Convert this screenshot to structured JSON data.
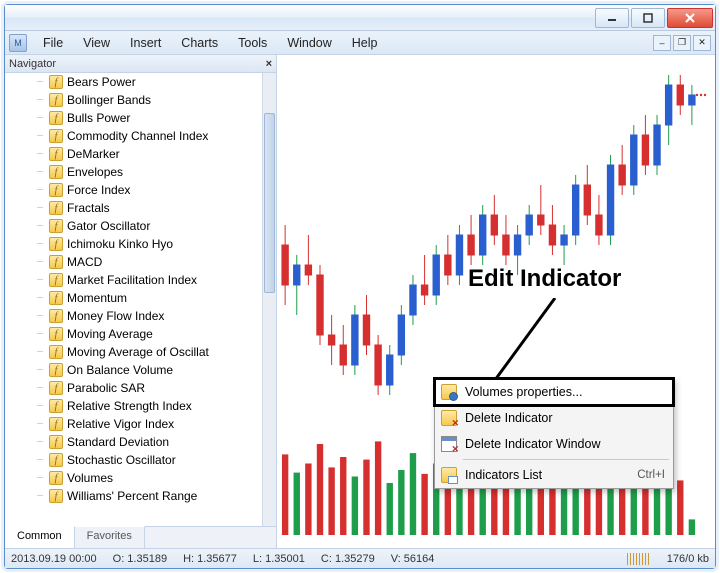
{
  "menubar": {
    "items": [
      "File",
      "View",
      "Insert",
      "Charts",
      "Tools",
      "Window",
      "Help"
    ]
  },
  "navigator": {
    "title": "Navigator",
    "tabs": {
      "active": "Common",
      "inactive": "Favorites"
    },
    "indicators": [
      "Bears Power",
      "Bollinger Bands",
      "Bulls Power",
      "Commodity Channel Index",
      "DeMarker",
      "Envelopes",
      "Force Index",
      "Fractals",
      "Gator Oscillator",
      "Ichimoku Kinko Hyo",
      "MACD",
      "Market Facilitation Index",
      "Momentum",
      "Money Flow Index",
      "Moving Average",
      "Moving Average of Oscillat",
      "On Balance Volume",
      "Parabolic SAR",
      "Relative Strength Index",
      "Relative Vigor Index",
      "Standard Deviation",
      "Stochastic Oscillator",
      "Volumes",
      "Williams' Percent Range"
    ]
  },
  "context_menu": {
    "items": [
      {
        "label": "Volumes properties...",
        "icon": "prop",
        "highlight": true
      },
      {
        "label": "Delete Indicator",
        "icon": "del"
      },
      {
        "label": "Delete Indicator Window",
        "icon": "delwin"
      },
      {
        "label": "Indicators List",
        "icon": "list",
        "accel": "Ctrl+I",
        "sep_before": true
      }
    ]
  },
  "annotation": {
    "text": "Edit Indicator"
  },
  "statusbar": {
    "datetime": "2013.09.19 00:00",
    "open": "O: 1.35189",
    "high": "H: 1.35677",
    "low": "L: 1.35001",
    "close": "C: 1.35279",
    "volume": "V: 56164",
    "traffic": "176/0 kb"
  },
  "chart_data": {
    "type": "candlestick+histogram",
    "note": "Approximate OHLC candles and volume histogram as visually depicted; values estimated from relative pixel heights (no axis labels visible).",
    "price_range_est": [
      1.335,
      1.367
    ],
    "candles": [
      {
        "o": 1.35,
        "h": 1.352,
        "l": 1.344,
        "c": 1.346,
        "dir": "down"
      },
      {
        "o": 1.346,
        "h": 1.349,
        "l": 1.343,
        "c": 1.348,
        "dir": "up"
      },
      {
        "o": 1.348,
        "h": 1.351,
        "l": 1.346,
        "c": 1.347,
        "dir": "down"
      },
      {
        "o": 1.347,
        "h": 1.348,
        "l": 1.34,
        "c": 1.341,
        "dir": "down"
      },
      {
        "o": 1.341,
        "h": 1.343,
        "l": 1.338,
        "c": 1.34,
        "dir": "down"
      },
      {
        "o": 1.34,
        "h": 1.342,
        "l": 1.337,
        "c": 1.338,
        "dir": "down"
      },
      {
        "o": 1.338,
        "h": 1.344,
        "l": 1.337,
        "c": 1.343,
        "dir": "up"
      },
      {
        "o": 1.343,
        "h": 1.345,
        "l": 1.339,
        "c": 1.34,
        "dir": "down"
      },
      {
        "o": 1.34,
        "h": 1.341,
        "l": 1.335,
        "c": 1.336,
        "dir": "down"
      },
      {
        "o": 1.336,
        "h": 1.34,
        "l": 1.335,
        "c": 1.339,
        "dir": "up"
      },
      {
        "o": 1.339,
        "h": 1.344,
        "l": 1.338,
        "c": 1.343,
        "dir": "up"
      },
      {
        "o": 1.343,
        "h": 1.347,
        "l": 1.342,
        "c": 1.346,
        "dir": "up"
      },
      {
        "o": 1.346,
        "h": 1.349,
        "l": 1.344,
        "c": 1.345,
        "dir": "down"
      },
      {
        "o": 1.345,
        "h": 1.35,
        "l": 1.344,
        "c": 1.349,
        "dir": "up"
      },
      {
        "o": 1.349,
        "h": 1.351,
        "l": 1.346,
        "c": 1.347,
        "dir": "down"
      },
      {
        "o": 1.347,
        "h": 1.352,
        "l": 1.346,
        "c": 1.351,
        "dir": "up"
      },
      {
        "o": 1.351,
        "h": 1.353,
        "l": 1.348,
        "c": 1.349,
        "dir": "down"
      },
      {
        "o": 1.349,
        "h": 1.354,
        "l": 1.348,
        "c": 1.353,
        "dir": "up"
      },
      {
        "o": 1.353,
        "h": 1.355,
        "l": 1.35,
        "c": 1.351,
        "dir": "down"
      },
      {
        "o": 1.351,
        "h": 1.353,
        "l": 1.348,
        "c": 1.349,
        "dir": "down"
      },
      {
        "o": 1.349,
        "h": 1.352,
        "l": 1.347,
        "c": 1.351,
        "dir": "up"
      },
      {
        "o": 1.351,
        "h": 1.354,
        "l": 1.35,
        "c": 1.353,
        "dir": "up"
      },
      {
        "o": 1.353,
        "h": 1.356,
        "l": 1.351,
        "c": 1.352,
        "dir": "down"
      },
      {
        "o": 1.352,
        "h": 1.354,
        "l": 1.349,
        "c": 1.35,
        "dir": "down"
      },
      {
        "o": 1.35,
        "h": 1.352,
        "l": 1.348,
        "c": 1.351,
        "dir": "up"
      },
      {
        "o": 1.351,
        "h": 1.357,
        "l": 1.35,
        "c": 1.356,
        "dir": "up"
      },
      {
        "o": 1.356,
        "h": 1.358,
        "l": 1.352,
        "c": 1.353,
        "dir": "down"
      },
      {
        "o": 1.353,
        "h": 1.355,
        "l": 1.35,
        "c": 1.351,
        "dir": "down"
      },
      {
        "o": 1.351,
        "h": 1.359,
        "l": 1.35,
        "c": 1.358,
        "dir": "up"
      },
      {
        "o": 1.358,
        "h": 1.36,
        "l": 1.355,
        "c": 1.356,
        "dir": "down"
      },
      {
        "o": 1.356,
        "h": 1.362,
        "l": 1.355,
        "c": 1.361,
        "dir": "up"
      },
      {
        "o": 1.361,
        "h": 1.363,
        "l": 1.357,
        "c": 1.358,
        "dir": "down"
      },
      {
        "o": 1.358,
        "h": 1.363,
        "l": 1.357,
        "c": 1.362,
        "dir": "up"
      },
      {
        "o": 1.362,
        "h": 1.367,
        "l": 1.36,
        "c": 1.366,
        "dir": "up"
      },
      {
        "o": 1.366,
        "h": 1.367,
        "l": 1.363,
        "c": 1.364,
        "dir": "down"
      },
      {
        "o": 1.364,
        "h": 1.366,
        "l": 1.362,
        "c": 1.365,
        "dir": "up"
      }
    ],
    "volume_range_est": [
      0,
      100
    ],
    "volumes": [
      {
        "v": 62,
        "dir": "down"
      },
      {
        "v": 48,
        "dir": "up"
      },
      {
        "v": 55,
        "dir": "down"
      },
      {
        "v": 70,
        "dir": "down"
      },
      {
        "v": 52,
        "dir": "down"
      },
      {
        "v": 60,
        "dir": "down"
      },
      {
        "v": 45,
        "dir": "up"
      },
      {
        "v": 58,
        "dir": "down"
      },
      {
        "v": 72,
        "dir": "down"
      },
      {
        "v": 40,
        "dir": "up"
      },
      {
        "v": 50,
        "dir": "up"
      },
      {
        "v": 63,
        "dir": "up"
      },
      {
        "v": 47,
        "dir": "down"
      },
      {
        "v": 55,
        "dir": "up"
      },
      {
        "v": 42,
        "dir": "down"
      },
      {
        "v": 60,
        "dir": "up"
      },
      {
        "v": 38,
        "dir": "down"
      },
      {
        "v": 52,
        "dir": "up"
      },
      {
        "v": 46,
        "dir": "down"
      },
      {
        "v": 50,
        "dir": "down"
      },
      {
        "v": 44,
        "dir": "up"
      },
      {
        "v": 56,
        "dir": "up"
      },
      {
        "v": 48,
        "dir": "down"
      },
      {
        "v": 52,
        "dir": "down"
      },
      {
        "v": 40,
        "dir": "up"
      },
      {
        "v": 68,
        "dir": "up"
      },
      {
        "v": 46,
        "dir": "down"
      },
      {
        "v": 50,
        "dir": "down"
      },
      {
        "v": 74,
        "dir": "up"
      },
      {
        "v": 44,
        "dir": "down"
      },
      {
        "v": 66,
        "dir": "up"
      },
      {
        "v": 48,
        "dir": "down"
      },
      {
        "v": 58,
        "dir": "up"
      },
      {
        "v": 80,
        "dir": "up"
      },
      {
        "v": 42,
        "dir": "down"
      },
      {
        "v": 12,
        "dir": "up"
      }
    ]
  }
}
